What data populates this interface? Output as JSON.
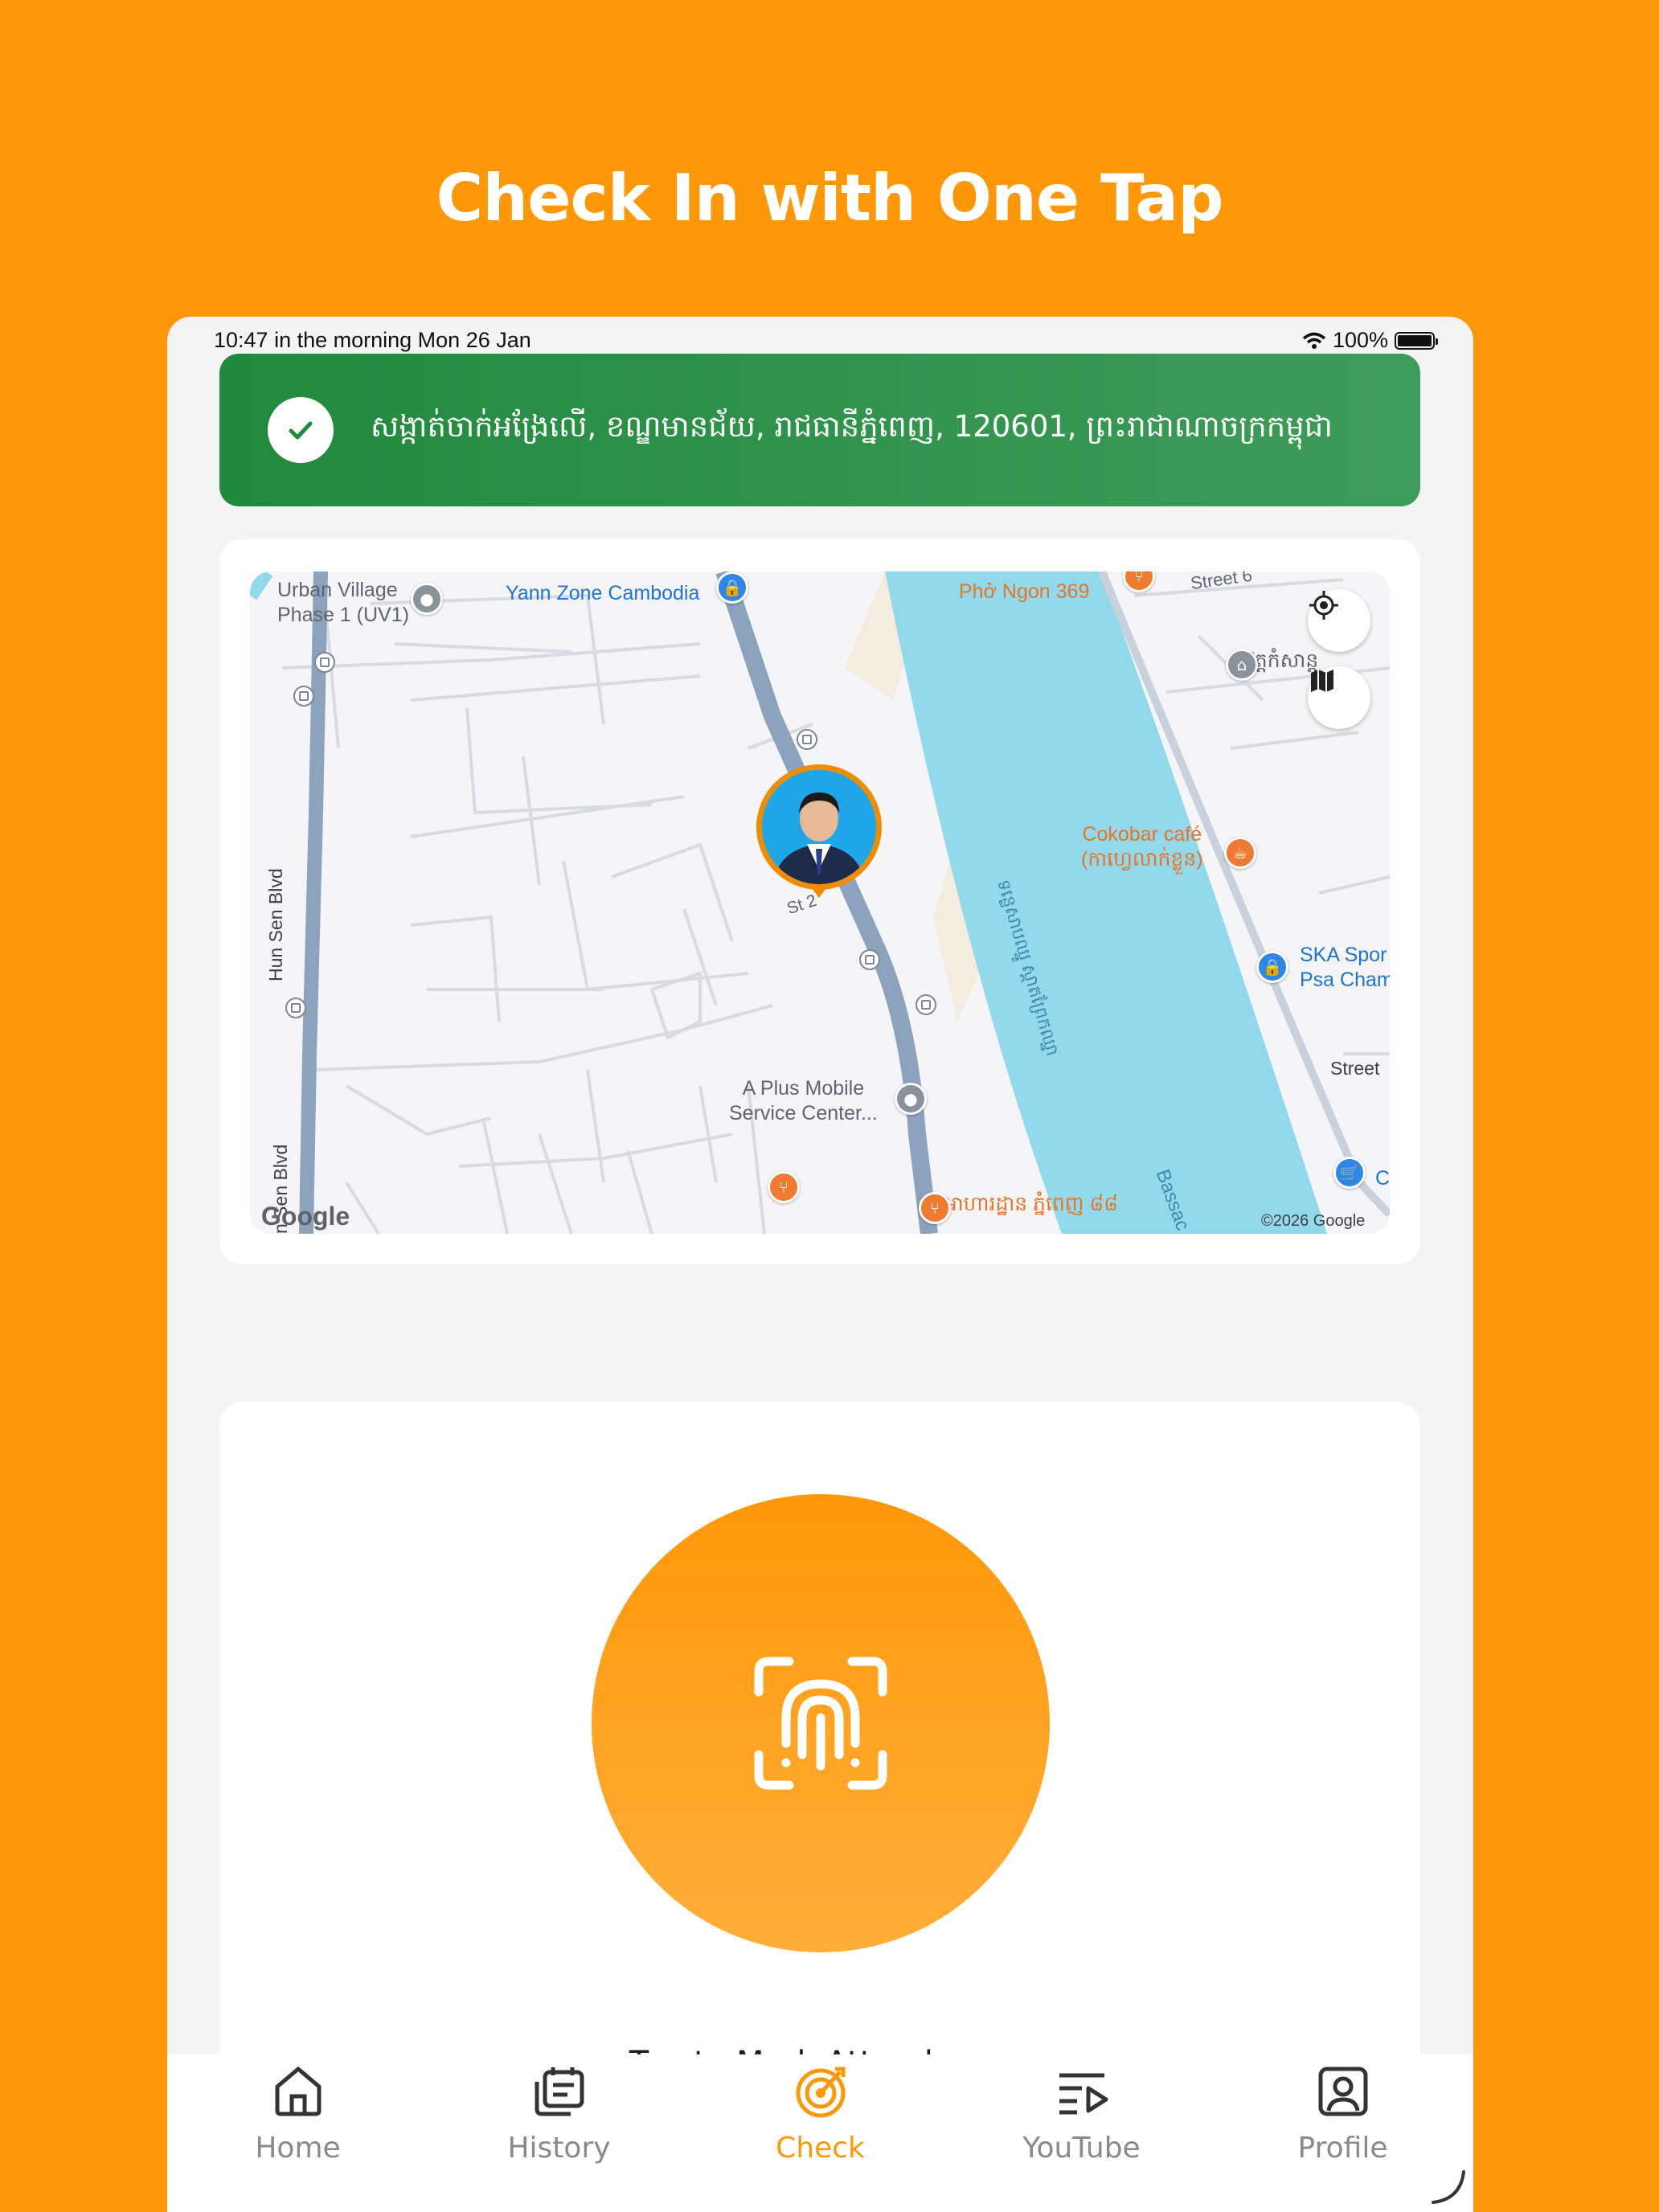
{
  "headline": "Check In with One Tap",
  "status_bar": {
    "time": "10:47 in the morning  Mon 26 Jan",
    "battery": "100%"
  },
  "banner": {
    "address": "សង្កាត់ចាក់អង្រែលើ, ខណ្ឌមានជ័យ, រាជធានីភ្នំពេញ, 120601, ព្រះរាជាណាចក្រកម្ពុជា"
  },
  "map": {
    "labels": {
      "urban_village": "Urban Village\nPhase 1 (UV1)",
      "yann_zone": "Yann Zone Cambodia",
      "pho_ngon": "Phở Ngon 369",
      "street_top": "Street 6",
      "wat": "វត្តកំសាន្ត",
      "cokobar": "Cokobar café\n(កាហ្វេលាក់ខ្លួន)",
      "ska": "SKA Spor\nPsa Cham",
      "street_right": "Street",
      "hun_sen_1": "Hun Sen Blvd",
      "hun_sen_2": "n Sen Blvd",
      "st2": "St 2",
      "a_plus": "A Plus Mobile\nService Center...",
      "restaurant": "អាហារដ្ឋាន ភ្នំពេញ ៨៨",
      "river": "ទន្លេសាបឈ្នូ ស្តាតព្រែកឈ្នា",
      "bassac": "Bassac",
      "google": "Google",
      "copyright": "©2026 Google",
      "c": "C"
    }
  },
  "attendance": {
    "label": "Tap to Mark Attendance"
  },
  "nav": {
    "items": [
      {
        "label": "Home",
        "icon": "home-icon"
      },
      {
        "label": "History",
        "icon": "history-icon"
      },
      {
        "label": "Check",
        "icon": "check-radar-icon",
        "active": true
      },
      {
        "label": "YouTube",
        "icon": "playlist-icon"
      },
      {
        "label": "Profile",
        "icon": "profile-icon"
      }
    ]
  },
  "colors": {
    "brand": "#FF9808",
    "success": "#208A3C",
    "river": "#92D9EC"
  }
}
